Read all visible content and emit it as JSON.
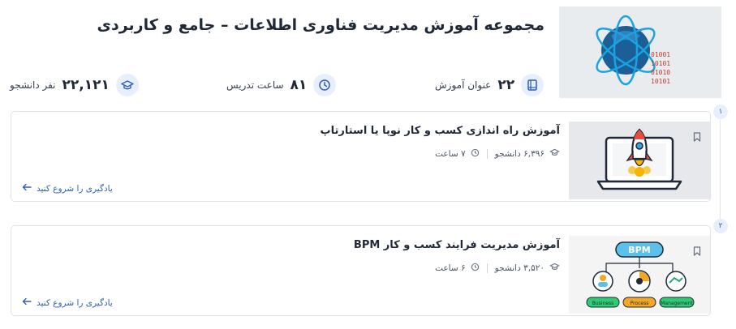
{
  "header": {
    "title": "مجموعه آموزش مدیریت فناوری اطلاعات – جامع و کاربردی",
    "image_icon": "atom-binary-icon"
  },
  "stats": {
    "courses": {
      "value": "۲۲",
      "label": "عنوان آموزش",
      "icon": "book-icon"
    },
    "hours": {
      "value": "۸۱",
      "label": "ساعت تدریس",
      "icon": "clock-icon"
    },
    "students": {
      "value": "۲۲,۱۲۱",
      "label": "نفر دانشجو",
      "icon": "graduation-cap-icon"
    }
  },
  "courses": [
    {
      "index": "۱",
      "title": "آموزش راه اندازی کسب و کار نوپا یا استارتاپ",
      "students": "۶,۳۹۶ دانشجو",
      "duration": "۷ ساعت",
      "cta": "یادگیری را شروع کنید",
      "thumb_icon": "rocket-laptop-icon"
    },
    {
      "index": "۲",
      "title": "آموزش مدیریت فرایند کسب و کار BPM",
      "students": "۳,۵۲۰ دانشجو",
      "duration": "۶ ساعت",
      "cta": "یادگیری را شروع کنید",
      "thumb_icon": "bpm-diagram-icon",
      "thumb_labels": {
        "top": "BPM",
        "a": "Business",
        "b": "Process",
        "c": "Management"
      }
    }
  ],
  "colors": {
    "accent": "#2f5fb3",
    "icon_bg": "#e7efff",
    "border": "#dfe3e8"
  }
}
